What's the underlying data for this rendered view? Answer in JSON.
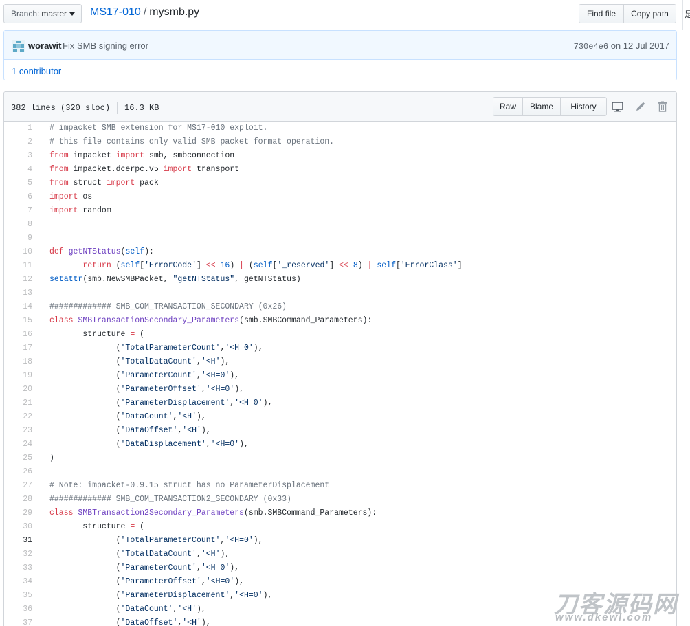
{
  "branch": {
    "prefix": "Branch:",
    "name": "master"
  },
  "breadcrumb": {
    "repo": "MS17-010",
    "separator": "/",
    "file": "mysmb.py"
  },
  "header_buttons": {
    "find_file": "Find file",
    "copy_path": "Copy path"
  },
  "edge_glyph": "是",
  "commit": {
    "author": "worawit",
    "message": "Fix SMB signing error",
    "sha": "730e4e6",
    "date": "on 12 Jul 2017",
    "contributors": "1 contributor"
  },
  "file": {
    "lines_info": "382 lines (320 sloc)",
    "size": "16.3 KB",
    "raw_label": "Raw",
    "blame_label": "Blame",
    "history_label": "History",
    "desktop_icon": "desktop-icon",
    "edit_icon": "pencil-icon",
    "delete_icon": "trash-icon"
  },
  "code_lines": [
    {
      "n": "1",
      "t": "# impacket SMB extension for MS17-010 exploit."
    },
    {
      "n": "2",
      "t": "# this file contains only valid SMB packet format operation."
    },
    {
      "n": "3",
      "t": "from impacket import smb, smbconnection"
    },
    {
      "n": "4",
      "t": "from impacket.dcerpc.v5 import transport"
    },
    {
      "n": "5",
      "t": "from struct import pack"
    },
    {
      "n": "6",
      "t": "import os"
    },
    {
      "n": "7",
      "t": "import random"
    },
    {
      "n": "8",
      "t": ""
    },
    {
      "n": "9",
      "t": ""
    },
    {
      "n": "10",
      "t": "def getNTStatus(self):"
    },
    {
      "n": "11",
      "t": "\treturn (self['ErrorCode'] << 16) | (self['_reserved'] << 8) | self['ErrorClass']"
    },
    {
      "n": "12",
      "t": "setattr(smb.NewSMBPacket, \"getNTStatus\", getNTStatus)"
    },
    {
      "n": "13",
      "t": ""
    },
    {
      "n": "14",
      "t": "############# SMB_COM_TRANSACTION_SECONDARY (0x26)"
    },
    {
      "n": "15",
      "t": "class SMBTransactionSecondary_Parameters(smb.SMBCommand_Parameters):"
    },
    {
      "n": "16",
      "t": "\tstructure = ("
    },
    {
      "n": "17",
      "t": "\t\t('TotalParameterCount','<H=0'),"
    },
    {
      "n": "18",
      "t": "\t\t('TotalDataCount','<H'),"
    },
    {
      "n": "19",
      "t": "\t\t('ParameterCount','<H=0'),"
    },
    {
      "n": "20",
      "t": "\t\t('ParameterOffset','<H=0'),"
    },
    {
      "n": "21",
      "t": "\t\t('ParameterDisplacement','<H=0'),"
    },
    {
      "n": "22",
      "t": "\t\t('DataCount','<H'),"
    },
    {
      "n": "23",
      "t": "\t\t('DataOffset','<H'),"
    },
    {
      "n": "24",
      "t": "\t\t('DataDisplacement','<H=0'),"
    },
    {
      "n": "25",
      "t": ")"
    },
    {
      "n": "26",
      "t": ""
    },
    {
      "n": "27",
      "t": "# Note: impacket-0.9.15 struct has no ParameterDisplacement"
    },
    {
      "n": "28",
      "t": "############# SMB_COM_TRANSACTION2_SECONDARY (0x33)"
    },
    {
      "n": "29",
      "t": "class SMBTransaction2Secondary_Parameters(smb.SMBCommand_Parameters):"
    },
    {
      "n": "30",
      "t": "\tstructure = ("
    },
    {
      "n": "31",
      "t": "\t\t('TotalParameterCount','<H=0'),"
    },
    {
      "n": "32",
      "t": "\t\t('TotalDataCount','<H'),"
    },
    {
      "n": "33",
      "t": "\t\t('ParameterCount','<H=0'),"
    },
    {
      "n": "34",
      "t": "\t\t('ParameterOffset','<H=0'),"
    },
    {
      "n": "35",
      "t": "\t\t('ParameterDisplacement','<H=0'),"
    },
    {
      "n": "36",
      "t": "\t\t('DataCount','<H'),"
    },
    {
      "n": "37",
      "t": "\t\t('DataOffset','<H'),"
    }
  ],
  "highlighted_line": "31",
  "watermark": {
    "cn": "刀客源码网",
    "url": "www.dkewl.com"
  },
  "colors": {
    "link": "#0366d6",
    "keyword": "#d73a49",
    "comment": "#6a737d",
    "string": "#032f62",
    "function": "#6f42c1",
    "builtin": "#005cc5"
  }
}
